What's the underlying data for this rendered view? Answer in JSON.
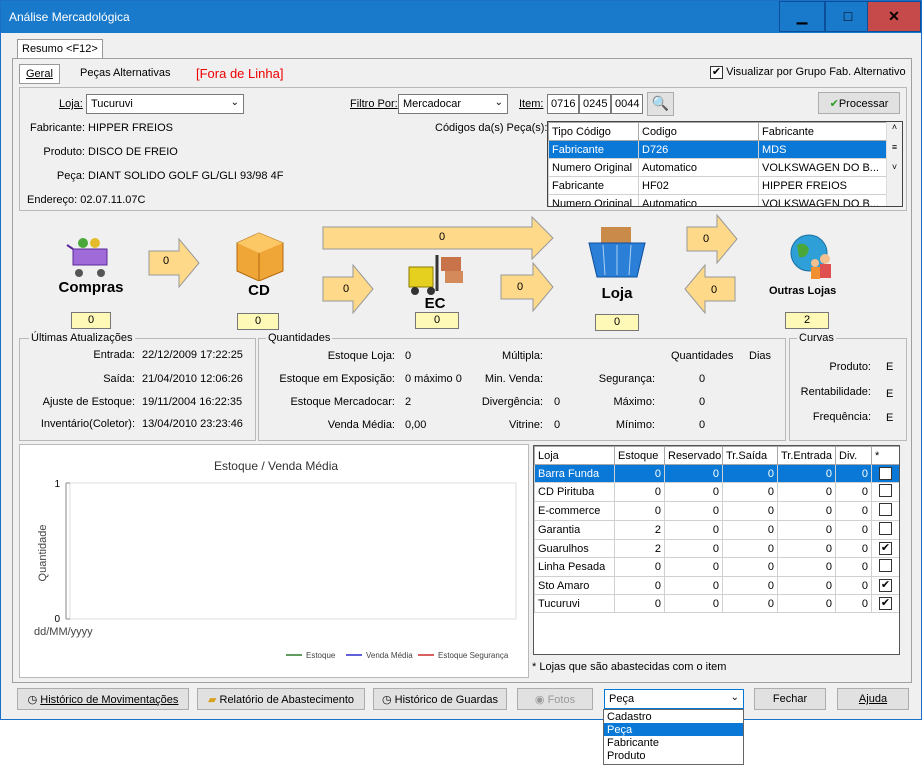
{
  "window": {
    "title": "Análise Mercadológica",
    "min": "▁",
    "max": "□",
    "close": "✕"
  },
  "tab": "Resumo <F12>",
  "subtabs": {
    "geral": "Geral",
    "alternativas": "Peças Alternativas",
    "fora": "[Fora de Linha]"
  },
  "visualizar": {
    "label": "Visualizar por Grupo Fab. Alternativo",
    "checked": "✔"
  },
  "filters": {
    "loja_label": "Loja:",
    "loja_value": "Tucuruvi",
    "filtro_label": "Filtro Por:",
    "filtro_value": "Mercadocar",
    "item_label": "Item:",
    "item_1": "0716",
    "item_2": "0245",
    "item_3": "0044",
    "processar": "Processar"
  },
  "info": {
    "fabricante_label": "Fabricante:",
    "fabricante": "HIPPER FREIOS",
    "produto_label": "Produto:",
    "produto": "DISCO DE FREIO",
    "peca_label": "Peça:",
    "peca": "DIANT SOLIDO GOLF GL/GLI 93/98 4F",
    "endereco_label": "Endereço:",
    "endereco": "02.07.11.07C",
    "codigos_label": "Códigos da(s) Peça(s):"
  },
  "codes": {
    "headers": [
      "Tipo Código",
      "Codigo",
      "Fabricante"
    ],
    "rows": [
      [
        "Fabricante",
        "D726",
        "MDS"
      ],
      [
        "Numero Original",
        "Automatico",
        "VOLKSWAGEN DO B..."
      ],
      [
        "Fabricante",
        "HF02",
        "HIPPER FREIOS"
      ],
      [
        "Numero Original",
        "Automatico",
        "VOLKSWAGEN DO B..."
      ]
    ]
  },
  "flow": {
    "compras": "Compras",
    "cd": "CD",
    "ec": "EC",
    "loja": "Loja",
    "outras": "Outras Lojas",
    "a1": "0",
    "a2": "0",
    "a3": "0",
    "a4": "0",
    "a5": "0",
    "a6": "0",
    "b_compras": "0",
    "b_cd": "0",
    "b_ec": "0",
    "b_loja": "0",
    "b_outras": "2"
  },
  "atualizacoes": {
    "title": "Últimas Atualizações",
    "rows": [
      [
        "Entrada:",
        "22/12/2009 17:22:25"
      ],
      [
        "Saída:",
        "21/04/2010 12:06:26"
      ],
      [
        "Ajuste de Estoque:",
        "19/11/2004 16:22:35"
      ],
      [
        "Inventário(Coletor):",
        "13/04/2010 23:23:46"
      ]
    ]
  },
  "quantidades": {
    "title": "Quantidades",
    "estoque_loja": "Estoque Loja:",
    "estoque_loja_v": "0",
    "exposicao": "Estoque em Exposição:",
    "exposicao_v": "0 máximo 0",
    "mercadocar": "Estoque Mercadocar:",
    "mercadocar_v": "2",
    "venda": "Venda Média:",
    "venda_v": "0,00",
    "multipla": "Múltipla:",
    "min_venda": "Min. Venda:",
    "divergencia": "Divergência:",
    "divergencia_v": "0",
    "vitrine": "Vitrine:",
    "vitrine_v": "0",
    "quantidades_h": "Quantidades",
    "dias_h": "Dias",
    "seguranca": "Segurança:",
    "seguranca_v": "0",
    "maximo": "Máximo:",
    "maximo_v": "0",
    "minimo": "Mínimo:",
    "minimo_v": "0"
  },
  "curvas": {
    "title": "Curvas",
    "rows": [
      [
        "Produto:",
        "E"
      ],
      [
        "Rentabilidade:",
        "E"
      ],
      [
        "Frequência:",
        "E"
      ]
    ]
  },
  "chart_data": {
    "type": "line",
    "title": "Estoque / Venda Média",
    "ylabel": "Quantidade",
    "xlabel": "dd/MM/yyyy",
    "ylim": [
      0,
      1
    ],
    "yticks": [
      "1",
      "0"
    ],
    "series": [
      {
        "name": "Estoque",
        "color": "#2a7a2a",
        "values": []
      },
      {
        "name": "Venda Média",
        "color": "#2a2acc",
        "values": []
      },
      {
        "name": "Estoque Segurança",
        "color": "#cc2a2a",
        "values": []
      }
    ]
  },
  "stores": {
    "headers": [
      "Loja",
      "Estoque",
      "Reservado",
      "Tr.Saída",
      "Tr.Entrada",
      "Div.",
      "*"
    ],
    "rows": [
      [
        "Barra Funda",
        "0",
        "0",
        "0",
        "0",
        "0",
        "✔"
      ],
      [
        "CD Pirituba",
        "0",
        "0",
        "0",
        "0",
        "0",
        ""
      ],
      [
        "E-commerce",
        "0",
        "0",
        "0",
        "0",
        "0",
        ""
      ],
      [
        "Garantia",
        "2",
        "0",
        "0",
        "0",
        "0",
        ""
      ],
      [
        "Guarulhos",
        "2",
        "0",
        "0",
        "0",
        "0",
        "✔"
      ],
      [
        "Linha Pesada",
        "0",
        "0",
        "0",
        "0",
        "0",
        ""
      ],
      [
        "Sto Amaro",
        "0",
        "0",
        "0",
        "0",
        "0",
        "✔"
      ],
      [
        "Tucuruvi",
        "0",
        "0",
        "0",
        "0",
        "0",
        "✔"
      ]
    ],
    "note": "* Lojas que são abastecidas com o item"
  },
  "footer": {
    "historico": "Histórico de Movimentações",
    "relatorio": "Relatório de Abastecimento",
    "guardas": "Histórico de Guardas",
    "fotos": "Fotos",
    "combo": "Peça",
    "fechar": "Fechar",
    "ajuda": "Ajuda"
  },
  "dropdown": {
    "options": [
      "Cadastro",
      "Peça",
      "Fabricante",
      "Produto"
    ],
    "selected": "Peça"
  }
}
